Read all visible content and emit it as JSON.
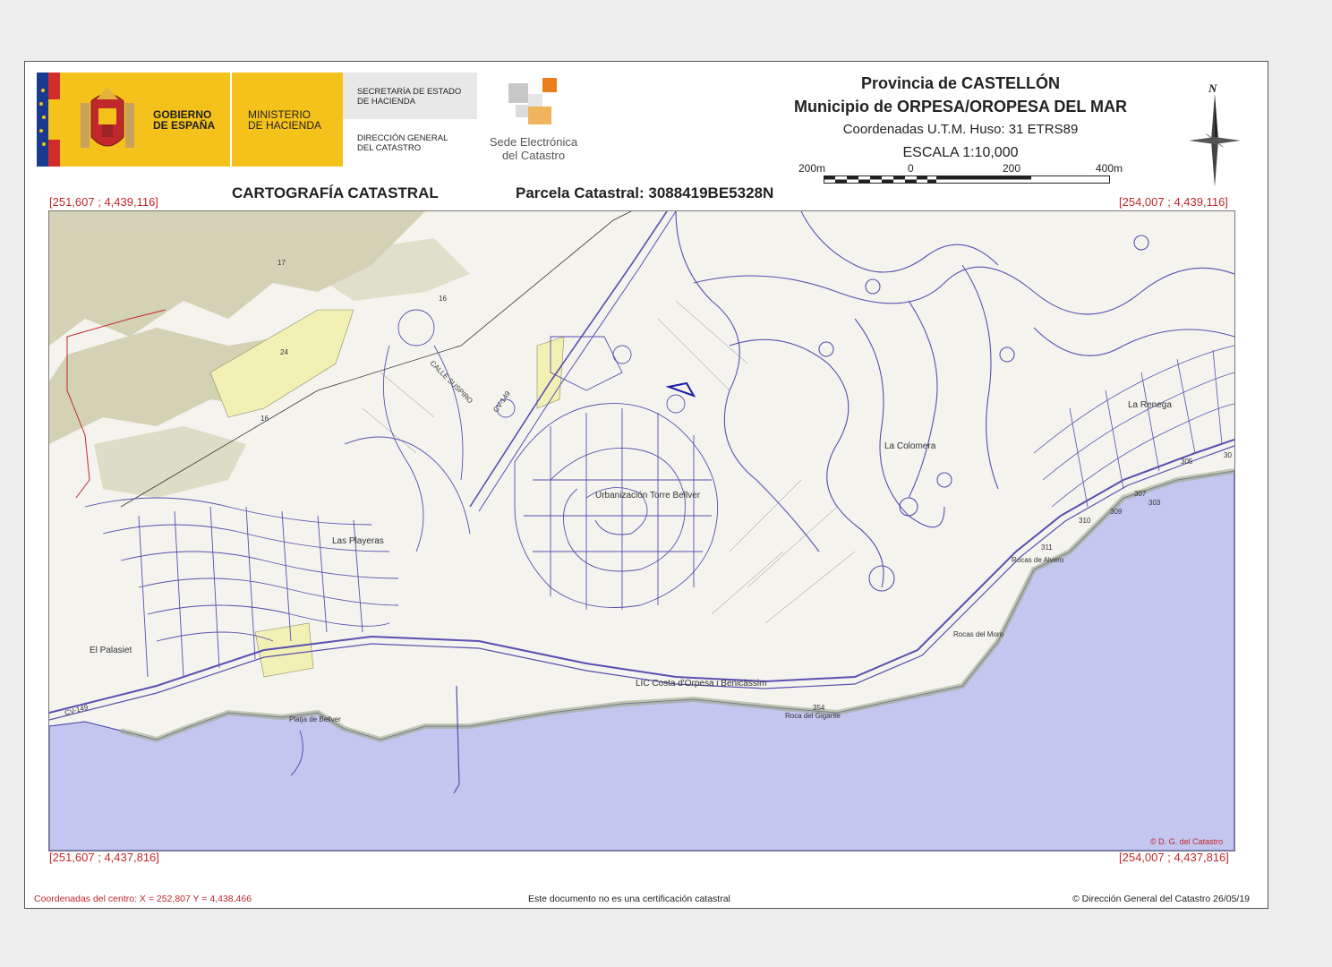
{
  "header": {
    "gobierno": [
      "GOBIERNO",
      "DE ESPAÑA"
    ],
    "ministerio": [
      "MINISTERIO",
      "DE HACIENDA"
    ],
    "secretaria": [
      "SECRETARÍA DE ESTADO",
      "DE HACIENDA"
    ],
    "direccion": [
      "DIRECCIÓN GENERAL",
      "DEL CATASTRO"
    ],
    "sede": [
      "Sede Electrónica",
      "del Catastro"
    ],
    "provincia": "Provincia de CASTELLÓN",
    "municipio": "Municipio de ORPESA/OROPESA DEL MAR",
    "coordenadas": "Coordenadas U.T.M. Huso: 31 ETRS89",
    "escala": "ESCALA 1:10,000",
    "scale_ticks": [
      "200m",
      "0",
      "200",
      "400m"
    ],
    "north": "N"
  },
  "titles": {
    "cartografia": "CARTOGRAFÍA CATASTRAL",
    "parcela": "Parcela Catastral: 3088419BE5328N"
  },
  "corners": {
    "top_left": "[251,607 ; 4,439,116]",
    "top_right": "[254,007 ; 4,439,116]",
    "bottom_left": "[251,607 ; 4,437,816]",
    "bottom_right": "[254,007 ; 4,437,816]"
  },
  "map": {
    "places": [
      "Las Playeras",
      "El Palasiet",
      "La Colomera",
      "La Renega",
      "Urbanización Torre Bellver",
      "LIC Costa d'Orpesa i Benicàssim",
      "Rocas del Moro",
      "Rocas de Alvero",
      "Roca del Gigante",
      "Platja de Bellver",
      "CALLE SUSPIRO",
      "CV-149",
      "CV-149"
    ],
    "labels": [
      "17",
      "16",
      "24",
      "16",
      "305",
      "307",
      "309",
      "310",
      "311",
      "303",
      "354",
      "30"
    ],
    "watermark": "© D. G. del Catastro"
  },
  "footer": {
    "centro": "Coordenadas del centro: X = 252,807 Y = 4,438,466",
    "nota": "Este documento no es una certificación catastral",
    "copyright": "© Dirección General del Catastro 26/05/19"
  },
  "colors": {
    "sea": "#c3c6ef",
    "parcel_line": "#5a4fb0",
    "land": "#f3f1ea",
    "yellow": "#f4f1b8",
    "relief": "#c9c8a4",
    "accent_red": "#c0282c"
  }
}
